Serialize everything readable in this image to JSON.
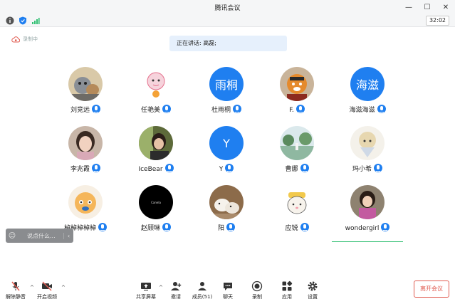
{
  "window": {
    "title": "腾讯会议"
  },
  "infobar": {
    "timer": "32:02"
  },
  "recording": {
    "label": "录制中"
  },
  "speaking": {
    "text": "正在讲话: 高磊;"
  },
  "participants": [
    {
      "name": "刘竞远",
      "avatar": "photo-cat",
      "mic": "on"
    },
    {
      "name": "任艳美",
      "avatar": "photo-cartoon-girl",
      "mic": "on"
    },
    {
      "name": "杜雨桐",
      "avatar_text": "雨桐",
      "avatar": "text",
      "mic": "on"
    },
    {
      "name": "F.",
      "avatar": "photo-tiger",
      "mic": "on"
    },
    {
      "name": "海滋海滋",
      "avatar_text": "海滋",
      "avatar": "text",
      "mic": "on"
    },
    {
      "name": "李兆霞",
      "avatar": "photo-person",
      "mic": "on"
    },
    {
      "name": "IceBear",
      "avatar": "photo-person-2",
      "mic": "on"
    },
    {
      "name": "Y",
      "avatar_text": "Y",
      "avatar": "text",
      "mic": "on"
    },
    {
      "name": "曹娜",
      "avatar": "photo-landscape",
      "mic": "on"
    },
    {
      "name": "玛小希",
      "avatar": "photo-anime",
      "mic": "on"
    },
    {
      "name": "棹棹棹棹棹",
      "avatar": "photo-cat-cartoon",
      "mic": "on"
    },
    {
      "name": "赵顾琳",
      "avatar": "photo-black",
      "avatar_text": "Canela",
      "mic": "on"
    },
    {
      "name": "阳",
      "avatar": "photo-dogs",
      "mic": "on"
    },
    {
      "name": "应锐",
      "avatar": "photo-dog-cartoon",
      "mic": "on"
    },
    {
      "name": "wondergirl",
      "avatar": "photo-girl",
      "mic": "speaking"
    }
  ],
  "chat": {
    "placeholder": "说点什么..."
  },
  "toolbar": {
    "unmute": "解除静音",
    "start_video": "开启视频",
    "share_screen": "共享屏幕",
    "invite": "邀请",
    "members": "成员(51)",
    "chat": "聊天",
    "record": "录制",
    "apps": "应用",
    "settings": "设置",
    "leave": "离开会议"
  },
  "colors": {
    "accent": "#1f7ff0",
    "leave": "#e05a4f",
    "speaking_bar": "#e6f0fc"
  }
}
